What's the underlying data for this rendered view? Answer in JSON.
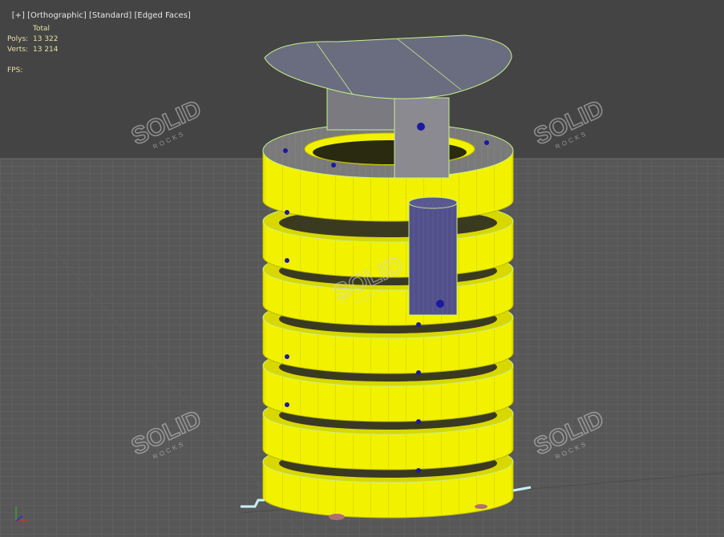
{
  "viewport_label": {
    "plus": "[+]",
    "view": "[Orthographic]",
    "shading": "[Standard]",
    "edges": "[Edged Faces]"
  },
  "stats": {
    "header": "Total",
    "polys_label": "Polys:",
    "polys_value": "13 322",
    "verts_label": "Verts:",
    "verts_value": "13 214",
    "fps_label": "FPS:"
  },
  "watermark": {
    "text": "SOLID",
    "subtext": "ROCKS"
  },
  "colors": {
    "background": "#444444",
    "grid": "#6a6a6a",
    "ring_yellow": "#f2f200",
    "ring_edge": "#b8b800",
    "wireframe": "#c8f08a",
    "roof": "#6a6c80",
    "post": "#52508a",
    "dot": "#1a1aa0"
  }
}
